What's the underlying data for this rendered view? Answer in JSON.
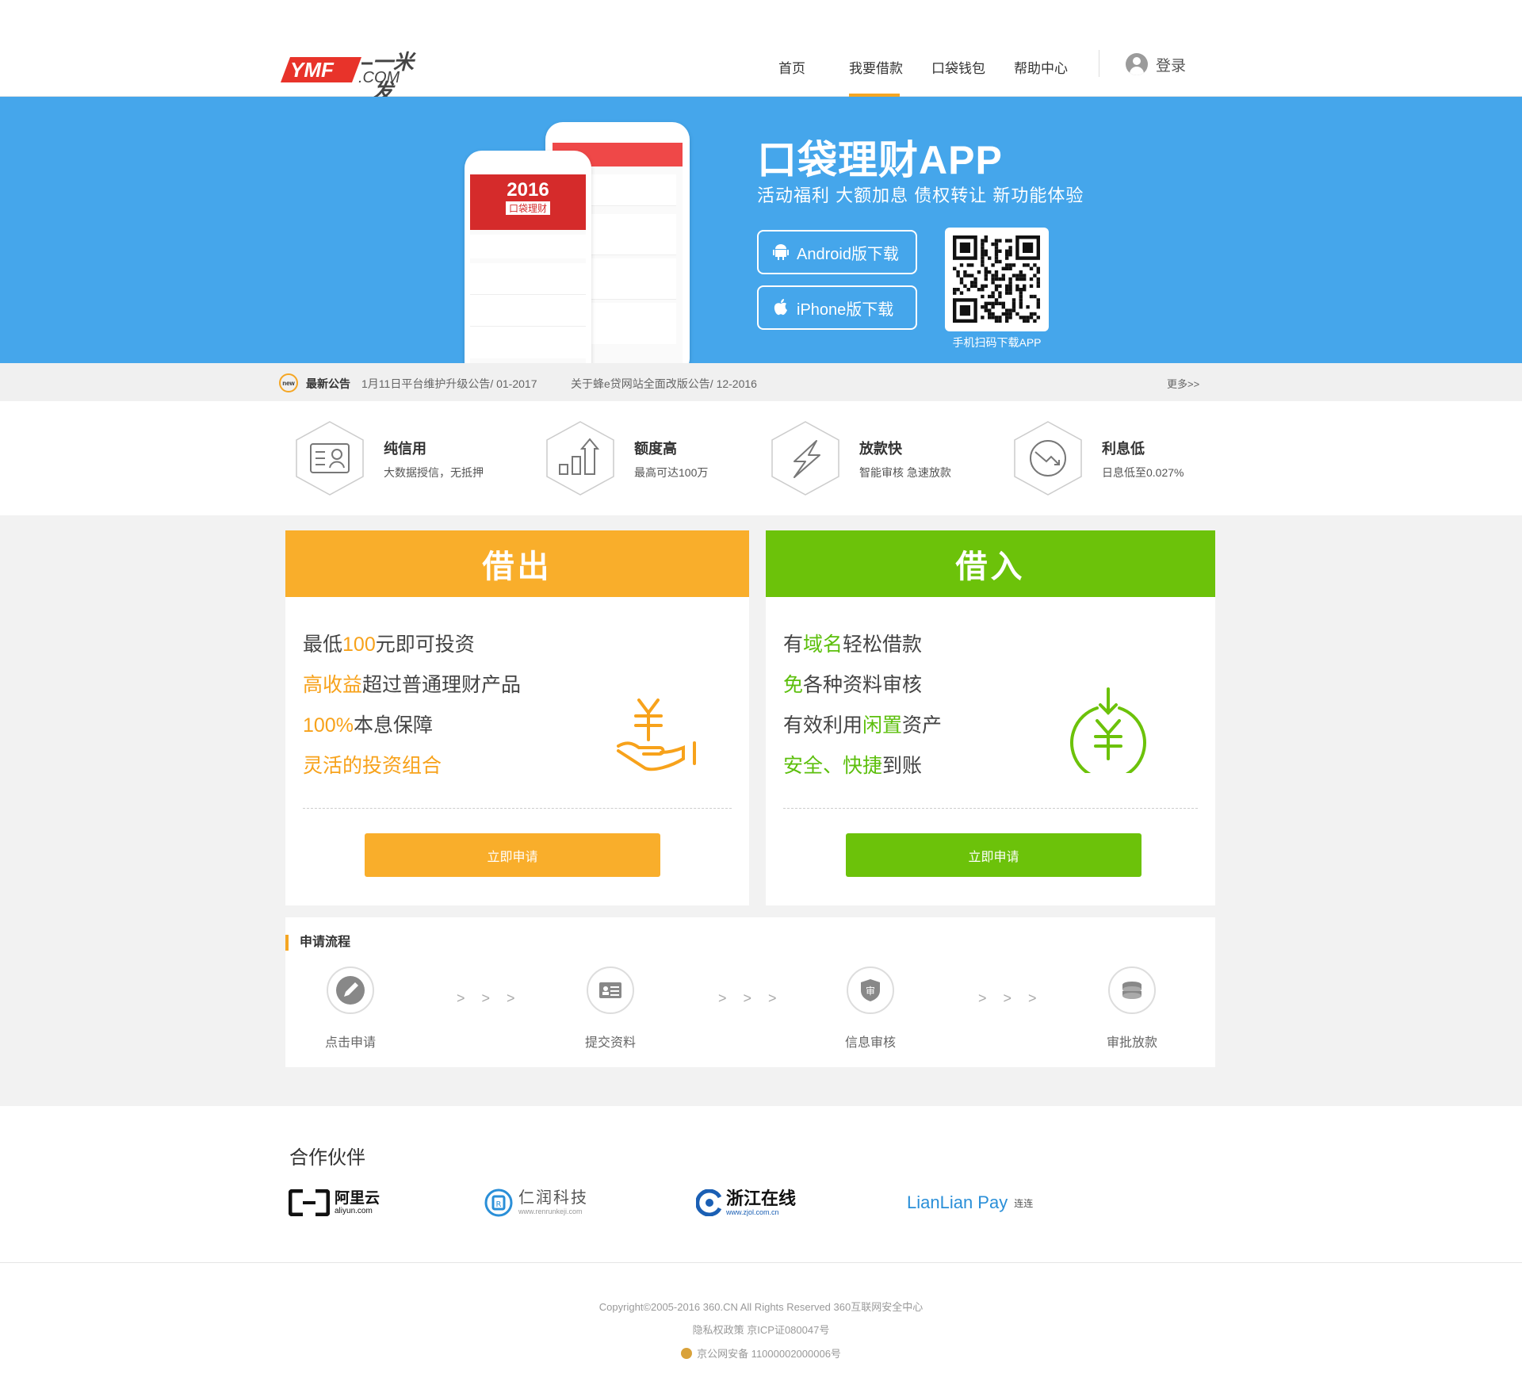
{
  "header": {
    "logo_text": "YMF",
    "logo_sub": "一米发",
    "logo_com": ".COM",
    "nav": [
      "首页",
      "我要借款",
      "口袋钱包",
      "帮助中心"
    ],
    "active_index": 1,
    "login_label": "登录"
  },
  "banner": {
    "title": "口袋理财APP",
    "subtitle": "活动福利  大额加息  债权转让  新功能体验",
    "android_btn": "Android版下载",
    "iphone_btn": "iPhone版下载",
    "qr_caption": "手机扫码下载APP",
    "phone_year": "2016",
    "phone_brand": "口袋理财"
  },
  "notice": {
    "badge": "new",
    "label": "最新公告",
    "items": [
      "1月11日平台维护升级公告/ 01-2017",
      "关于蜂e贷网站全面改版公告/ 12-2016"
    ],
    "more": "更多>>"
  },
  "features": [
    {
      "title": "纯信用",
      "desc": "大数据授信，无抵押",
      "icon": "id-card-icon"
    },
    {
      "title": "额度高",
      "desc": "最高可达100万",
      "icon": "bar-chart-up-icon"
    },
    {
      "title": "放款快",
      "desc": "智能审核 急速放款",
      "icon": "lightning-icon"
    },
    {
      "title": "利息低",
      "desc": "日息低至0.027%",
      "icon": "trend-down-icon"
    }
  ],
  "lend": {
    "header": "借出",
    "lines": [
      [
        {
          "t": "最低"
        },
        {
          "t": "100",
          "h": 1
        },
        {
          "t": "元即可投资"
        }
      ],
      [
        {
          "t": "高收益",
          "h": 1
        },
        {
          "t": "超过普通理财产品"
        }
      ],
      [
        {
          "t": "100%",
          "h": 1
        },
        {
          "t": "本息保障"
        }
      ],
      [
        {
          "t": "灵活的投资组合",
          "h": 1
        }
      ]
    ],
    "button": "立即申请",
    "color": "#f9ae2b"
  },
  "borrow": {
    "header": "借入",
    "lines": [
      [
        {
          "t": "有"
        },
        {
          "t": "域名",
          "h": 1
        },
        {
          "t": "轻松借款"
        }
      ],
      [
        {
          "t": "免",
          "h": 1
        },
        {
          "t": "各种资料审核"
        }
      ],
      [
        {
          "t": "有效利用"
        },
        {
          "t": "闲置",
          "h": 1
        },
        {
          "t": "资产"
        }
      ],
      [
        {
          "t": "安全、快捷",
          "h": 1
        },
        {
          "t": "到账"
        }
      ]
    ],
    "button": "立即申请",
    "color": "#6cc20a"
  },
  "process": {
    "title": "申请流程",
    "steps": [
      "点击申请",
      "提交资料",
      "信息审核",
      "审批放款"
    ],
    "arrow": "> > >"
  },
  "partners": {
    "title": "合作伙伴",
    "aliyun": {
      "cn": "阿里云",
      "en": "aliyun.com"
    },
    "renrun": {
      "cn": "仁润科技",
      "en": "www.renrunkeji.com"
    },
    "zjol": {
      "cn": "浙江在线",
      "en": "www.zjol.com.cn"
    },
    "lianlian": {
      "en": "LianLian Pay",
      "cn": "连连"
    }
  },
  "footer": {
    "copyright": "Copyright©2005-2016 360.CN All Rights Reserved 360互联网安全中心",
    "icp": "隐私权政策 京ICP证080047号",
    "police": "京公网安备 11000002000006号"
  }
}
